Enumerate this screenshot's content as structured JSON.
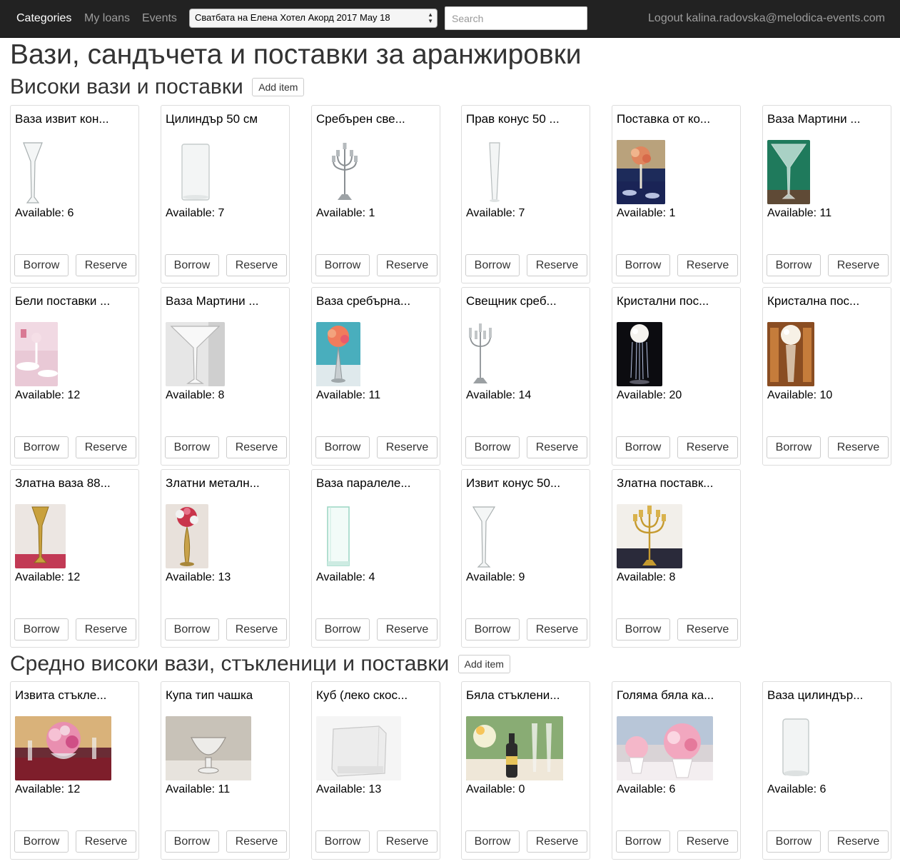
{
  "nav": {
    "categories": "Categories",
    "my_loans": "My loans",
    "events": "Events",
    "event_selected": "Сватбата на Елена Хотел Акорд 2017 May 18",
    "search_placeholder": "Search",
    "logout": "Logout kalina.radovska@melodica-events.com"
  },
  "page_title": "Вази, сандъчета и поставки за аранжировки",
  "labels": {
    "borrow": "Borrow",
    "reserve": "Reserve",
    "add_item": "Add item"
  },
  "sections": [
    {
      "title": "Високи вази и поставки",
      "items": [
        {
          "name": "Ваза извит кон...",
          "available": "Available: 6",
          "icon": "tall-curved-vase"
        },
        {
          "name": "Цилиндър 50 см",
          "available": "Available: 7",
          "icon": "glass-cylinder"
        },
        {
          "name": "Сребърен све...",
          "available": "Available: 1",
          "icon": "silver-candelabra"
        },
        {
          "name": "Прав конус 50 ...",
          "available": "Available: 7",
          "icon": "straight-cone-vase"
        },
        {
          "name": "Поставка от ко...",
          "available": "Available: 1",
          "icon": "flower-stand-photo"
        },
        {
          "name": "Ваза Мартини ...",
          "available": "Available: 11",
          "icon": "martini-vase-green"
        },
        {
          "name": "Бели поставки ...",
          "available": "Available: 12",
          "icon": "white-stands-photo"
        },
        {
          "name": "Ваза Мартини ...",
          "available": "Available: 8",
          "icon": "martini-vase-grey"
        },
        {
          "name": "Ваза сребърна...",
          "available": "Available: 11",
          "icon": "silver-vase-flowers"
        },
        {
          "name": "Свещник среб...",
          "available": "Available: 14",
          "icon": "silver-candlestick"
        },
        {
          "name": "Кристални пос...",
          "available": "Available: 20",
          "icon": "crystal-stand-dark"
        },
        {
          "name": "Кристална пос...",
          "available": "Available: 10",
          "icon": "crystal-stand-warm"
        },
        {
          "name": "Златна ваза 88...",
          "available": "Available: 12",
          "icon": "gold-vase"
        },
        {
          "name": "Златни металн...",
          "available": "Available: 13",
          "icon": "gold-stand-flowers"
        },
        {
          "name": "Ваза паралеле...",
          "available": "Available: 4",
          "icon": "glass-box-vase"
        },
        {
          "name": "Извит конус 50...",
          "available": "Available: 9",
          "icon": "curved-cone-vase"
        },
        {
          "name": "Златна поставк...",
          "available": "Available: 8",
          "icon": "gold-candelabra"
        }
      ]
    },
    {
      "title": "Средно високи вази, стъкленици и поставки",
      "items": [
        {
          "name": "Извита стъкле...",
          "available": "Available: 12",
          "icon": "bowl-flowers-photo"
        },
        {
          "name": "Купа тип чашка",
          "available": "Available: 11",
          "icon": "glass-cup-bowl"
        },
        {
          "name": "Куб (леко скос...",
          "available": "Available: 13",
          "icon": "glass-cube"
        },
        {
          "name": "Бяла стъклени...",
          "available": "Available: 0",
          "icon": "white-bottle-photo"
        },
        {
          "name": "Голяма бяла ка...",
          "available": "Available: 6",
          "icon": "white-planter-photo"
        },
        {
          "name": "Ваза цилиндър...",
          "available": "Available: 6",
          "icon": "glass-cylinder-small"
        }
      ]
    }
  ]
}
